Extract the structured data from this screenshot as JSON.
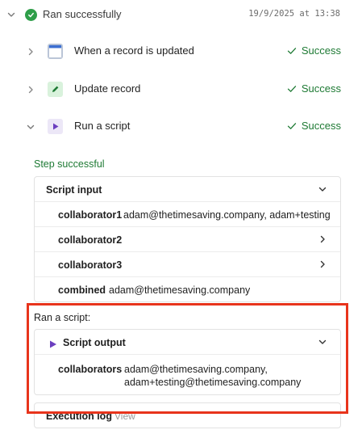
{
  "run": {
    "title": "Ran successfully",
    "timestamp": "19/9/2025 at 13:38"
  },
  "steps": [
    {
      "label": "When a record is updated",
      "status": "Success",
      "icon": "trigger-window-icon"
    },
    {
      "label": "Update record",
      "status": "Success",
      "icon": "pencil-icon"
    },
    {
      "label": "Run a script",
      "status": "Success",
      "icon": "play-icon"
    }
  ],
  "step_detail": {
    "note": "Step successful",
    "script_input": {
      "title": "Script input",
      "rows": [
        {
          "key": "collaborator1",
          "value": "adam@thetimesaving.company, adam+testing@"
        },
        {
          "key": "collaborator2",
          "value": ""
        },
        {
          "key": "collaborator3",
          "value": ""
        },
        {
          "key": "combined",
          "value": "adam@thetimesaving.company"
        }
      ]
    },
    "ran_label": "Ran a script:",
    "script_output": {
      "title": "Script output",
      "rows": [
        {
          "key": "collaborators",
          "value_line1": "adam@thetimesaving.company,",
          "value_line2": "adam+testing@thetimesaving.company"
        }
      ]
    },
    "execution_log": {
      "title": "Execution log",
      "action": "View"
    }
  },
  "colors": {
    "success_green": "#1e7a34",
    "check_circle": "#2e9e49",
    "highlight_red": "#e8341c",
    "script_purple": "#6b3fbf"
  }
}
